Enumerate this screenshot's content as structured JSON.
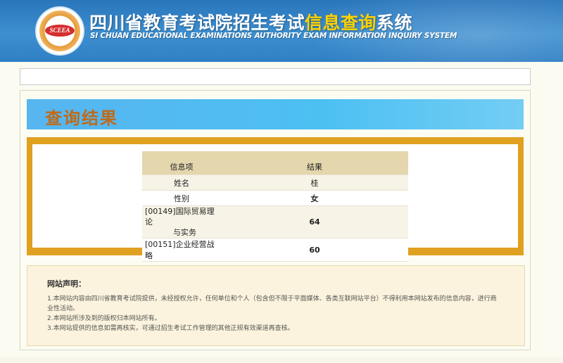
{
  "header": {
    "title_part1": "四川省教育考试院招生考试",
    "title_part2": "信息查询",
    "title_part3": "系统",
    "subtitle": "SI CHUAN EDUCATIONAL EXAMINATIONS AUTHORITY EXAM INFORMATION INQUIRY SYSTEM",
    "logo_text": "SCEEA"
  },
  "result": {
    "title": "查询结果",
    "columns": [
      "信息项",
      "结果"
    ],
    "rows": [
      {
        "label": "姓名",
        "value": "桂"
      },
      {
        "label": "性别",
        "value": "女"
      },
      {
        "label_line1": "[00149]国际贸易理论",
        "label_line2": "与实务",
        "value": "64"
      },
      {
        "label": "[00151]企业经营战略",
        "value": "60"
      }
    ]
  },
  "notice": {
    "title": "网站声明：",
    "line1a": "1.本网站内容由四川省教育考试院提供，未经授权允许，任何单位和个人（包含但不限于平面媒体、各类互联网站平台）不得利用本网站发布的信息内容，进行商",
    "line1b": "业性活动。",
    "line2": "2.本网站所涉及到的版权归本网站所有。",
    "line3": "3.本网站提供的信息如需再核实，可通过招生考试工作管理的其他正规有效渠道再查核。"
  },
  "colors": {
    "header_blue": "#2f7fc4",
    "highlight_yellow": "#ffd200",
    "result_title_bg": "#4dc0f2",
    "result_title_text": "#c06a17",
    "gold_frame": "#e0a020",
    "table_header": "#e4d6ad",
    "notice_bg": "#fbf3dd"
  }
}
